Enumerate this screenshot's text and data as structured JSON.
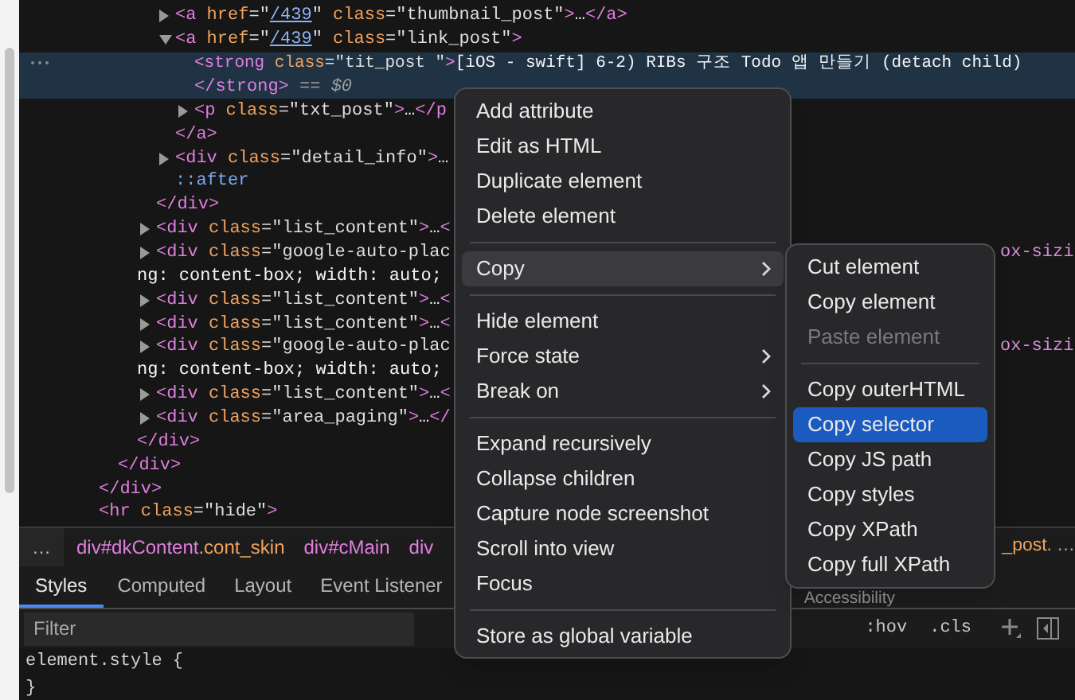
{
  "dom_tree": [
    {
      "children": [
        {
          "children": [
            {
              "children": [
                {
                  "children": [
                    {
                      "expanded": false,
                      "selected": false,
                      "segments": [
                        {
                          "kind": "tag",
                          "text": "<a"
                        },
                        {
                          "kind": "attr",
                          "text": " href"
                        },
                        {
                          "kind": "value",
                          "text": "=\""
                        },
                        {
                          "kind": "link",
                          "text": "/439"
                        },
                        {
                          "kind": "value",
                          "text": "\""
                        },
                        {
                          "kind": "attr",
                          "text": " class"
                        },
                        {
                          "kind": "value",
                          "text": "=\"thumbnail_post\""
                        },
                        {
                          "kind": "tag",
                          "text": ">"
                        },
                        {
                          "kind": "text",
                          "text": "…"
                        },
                        {
                          "kind": "tag",
                          "text": "</a>"
                        }
                      ]
                    },
                    {
                      "expanded": true,
                      "selected": false,
                      "segments": [
                        {
                          "kind": "tag",
                          "text": "<a"
                        },
                        {
                          "kind": "attr",
                          "text": " href"
                        },
                        {
                          "kind": "value",
                          "text": "=\""
                        },
                        {
                          "kind": "link",
                          "text": "/439"
                        },
                        {
                          "kind": "value",
                          "text": "\""
                        },
                        {
                          "kind": "attr",
                          "text": " class"
                        },
                        {
                          "kind": "value",
                          "text": "=\"link_post\""
                        },
                        {
                          "kind": "tag",
                          "text": ">"
                        }
                      ],
                      "children": [
                        {
                          "selected": true,
                          "segments": [
                            {
                              "kind": "tag",
                              "text": "<strong"
                            },
                            {
                              "kind": "attr",
                              "text": " class"
                            },
                            {
                              "kind": "value",
                              "text": "=\"tit_post \""
                            },
                            {
                              "kind": "tag",
                              "text": ">"
                            },
                            {
                              "kind": "text",
                              "text": "[iOS - swift] 6-2) RIBs 구조 Todo 앱 만들기 (detach child)"
                            }
                          ],
                          "continuation": {
                            "hanging": false,
                            "segments": [
                              {
                                "kind": "tag",
                                "text": "</strong>"
                              },
                              {
                                "kind": "muted",
                                "text": " == "
                              },
                              {
                                "kind": "var",
                                "text": "$0"
                              }
                            ]
                          }
                        },
                        {
                          "expanded": false,
                          "selected": false,
                          "segments": [
                            {
                              "kind": "tag",
                              "text": "<p"
                            },
                            {
                              "kind": "attr",
                              "text": " class"
                            },
                            {
                              "kind": "value",
                              "text": "=\"txt_post\""
                            },
                            {
                              "kind": "tag",
                              "text": ">"
                            },
                            {
                              "kind": "text",
                              "text": "…"
                            },
                            {
                              "kind": "tag",
                              "text": "</p"
                            }
                          ]
                        }
                      ]
                    },
                    {
                      "selected": false,
                      "segments": [
                        {
                          "kind": "tag",
                          "text": "</a>"
                        }
                      ]
                    },
                    {
                      "expanded": false,
                      "selected": false,
                      "segments": [
                        {
                          "kind": "tag",
                          "text": "<div"
                        },
                        {
                          "kind": "attr",
                          "text": " class"
                        },
                        {
                          "kind": "value",
                          "text": "=\"detail_info\""
                        },
                        {
                          "kind": "tag",
                          "text": ">"
                        },
                        {
                          "kind": "text",
                          "text": "…"
                        }
                      ]
                    },
                    {
                      "selected": false,
                      "segments": [
                        {
                          "kind": "pseudo",
                          "text": "::after"
                        }
                      ]
                    }
                  ]
                },
                {
                  "selected": false,
                  "segments": [
                    {
                      "kind": "tag",
                      "text": "</div>"
                    }
                  ]
                },
                {
                  "expanded": false,
                  "selected": false,
                  "segments": [
                    {
                      "kind": "tag",
                      "text": "<div"
                    },
                    {
                      "kind": "attr",
                      "text": " class"
                    },
                    {
                      "kind": "value",
                      "text": "=\"list_content\""
                    },
                    {
                      "kind": "tag",
                      "text": ">"
                    },
                    {
                      "kind": "text",
                      "text": "…"
                    },
                    {
                      "kind": "tag",
                      "text": "<"
                    }
                  ]
                },
                {
                  "expanded": false,
                  "selected": false,
                  "segments": [
                    {
                      "kind": "tag",
                      "text": "<div"
                    },
                    {
                      "kind": "attr",
                      "text": " class"
                    },
                    {
                      "kind": "value",
                      "text": "=\"google-auto-plac"
                    }
                  ],
                  "right_fragment": "ox-sizi",
                  "continuation": {
                    "hanging": true,
                    "segments": [
                      {
                        "kind": "text",
                        "text": "ng: content-box; width: auto;"
                      }
                    ]
                  }
                },
                {
                  "expanded": false,
                  "selected": false,
                  "segments": [
                    {
                      "kind": "tag",
                      "text": "<div"
                    },
                    {
                      "kind": "attr",
                      "text": " class"
                    },
                    {
                      "kind": "value",
                      "text": "=\"list_content\""
                    },
                    {
                      "kind": "tag",
                      "text": ">"
                    },
                    {
                      "kind": "text",
                      "text": "…"
                    },
                    {
                      "kind": "tag",
                      "text": "<"
                    }
                  ]
                },
                {
                  "expanded": false,
                  "selected": false,
                  "segments": [
                    {
                      "kind": "tag",
                      "text": "<div"
                    },
                    {
                      "kind": "attr",
                      "text": " class"
                    },
                    {
                      "kind": "value",
                      "text": "=\"list_content\""
                    },
                    {
                      "kind": "tag",
                      "text": ">"
                    },
                    {
                      "kind": "text",
                      "text": "…"
                    },
                    {
                      "kind": "tag",
                      "text": "<"
                    }
                  ]
                },
                {
                  "expanded": false,
                  "selected": false,
                  "segments": [
                    {
                      "kind": "tag",
                      "text": "<div"
                    },
                    {
                      "kind": "attr",
                      "text": " class"
                    },
                    {
                      "kind": "value",
                      "text": "=\"google-auto-plac"
                    }
                  ],
                  "right_fragment": "ox-sizi",
                  "continuation": {
                    "hanging": true,
                    "segments": [
                      {
                        "kind": "text",
                        "text": "ng: content-box; width: auto;"
                      }
                    ]
                  }
                },
                {
                  "expanded": false,
                  "selected": false,
                  "segments": [
                    {
                      "kind": "tag",
                      "text": "<div"
                    },
                    {
                      "kind": "attr",
                      "text": " class"
                    },
                    {
                      "kind": "value",
                      "text": "=\"list_content\""
                    },
                    {
                      "kind": "tag",
                      "text": ">"
                    },
                    {
                      "kind": "text",
                      "text": "…"
                    },
                    {
                      "kind": "tag",
                      "text": "<"
                    }
                  ]
                },
                {
                  "expanded": false,
                  "selected": false,
                  "segments": [
                    {
                      "kind": "tag",
                      "text": "<div"
                    },
                    {
                      "kind": "attr",
                      "text": " class"
                    },
                    {
                      "kind": "value",
                      "text": "=\"area_paging\""
                    },
                    {
                      "kind": "tag",
                      "text": ">"
                    },
                    {
                      "kind": "text",
                      "text": "…"
                    },
                    {
                      "kind": "tag",
                      "text": "</"
                    }
                  ]
                }
              ]
            },
            {
              "selected": false,
              "segments": [
                {
                  "kind": "tag",
                  "text": "</div>"
                }
              ]
            }
          ]
        },
        {
          "selected": false,
          "segments": [
            {
              "kind": "tag",
              "text": "</div>"
            }
          ]
        }
      ]
    },
    {
      "selected": false,
      "segments": [
        {
          "kind": "tag",
          "text": "</div>"
        }
      ]
    },
    {
      "selected": false,
      "segments": [
        {
          "kind": "tag",
          "text": "<hr"
        },
        {
          "kind": "attr",
          "text": " class"
        },
        {
          "kind": "value",
          "text": "=\"hide\""
        },
        {
          "kind": "tag",
          "text": ">"
        }
      ]
    }
  ],
  "breadcrumbs": {
    "more": "…",
    "items": [
      {
        "segments": [
          {
            "kind": "tag",
            "text": "div#dkContent"
          },
          {
            "kind": "class",
            "text": ".cont_skin"
          }
        ]
      },
      {
        "segments": [
          {
            "kind": "tag",
            "text": "div#cMain"
          }
        ]
      },
      {
        "segments": [
          {
            "kind": "tag",
            "text": "div"
          }
        ]
      }
    ],
    "right_items": [
      {
        "segments": [
          {
            "kind": "class",
            "text": "_post."
          }
        ]
      }
    ],
    "overflow": "…"
  },
  "tabs": [
    {
      "label": "Styles",
      "selected": true
    },
    {
      "label": "Computed",
      "selected": false
    },
    {
      "label": "Layout",
      "selected": false
    },
    {
      "label": "Event Listener",
      "selected": false
    }
  ],
  "right_tab": "Accessibility",
  "filter": {
    "placeholder": "Filter",
    "hov": ":hov",
    "cls": ".cls"
  },
  "styles": [
    "element.style {",
    "}"
  ],
  "context_menu": {
    "focused": false,
    "items": [
      {
        "kind": "item",
        "label": "Add attribute",
        "submenu": false,
        "selected": false
      },
      {
        "kind": "item",
        "label": "Edit as HTML",
        "submenu": false,
        "selected": false
      },
      {
        "kind": "item",
        "label": "Duplicate element",
        "submenu": false,
        "selected": false
      },
      {
        "kind": "item",
        "label": "Delete element",
        "submenu": false,
        "selected": false
      },
      {
        "kind": "separator"
      },
      {
        "kind": "item",
        "label": "Copy",
        "submenu": true,
        "selected": true
      },
      {
        "kind": "separator"
      },
      {
        "kind": "item",
        "label": "Hide element",
        "submenu": false,
        "selected": false
      },
      {
        "kind": "item",
        "label": "Force state",
        "submenu": true,
        "selected": false
      },
      {
        "kind": "item",
        "label": "Break on",
        "submenu": true,
        "selected": false
      },
      {
        "kind": "separator"
      },
      {
        "kind": "item",
        "label": "Expand recursively",
        "submenu": false,
        "selected": false
      },
      {
        "kind": "item",
        "label": "Collapse children",
        "submenu": false,
        "selected": false
      },
      {
        "kind": "item",
        "label": "Capture node screenshot",
        "submenu": false,
        "selected": false
      },
      {
        "kind": "item",
        "label": "Scroll into view",
        "submenu": false,
        "selected": false
      },
      {
        "kind": "item",
        "label": "Focus",
        "submenu": false,
        "selected": false
      },
      {
        "kind": "separator"
      },
      {
        "kind": "item",
        "label": "Store as global variable",
        "submenu": false,
        "selected": false
      }
    ]
  },
  "submenu": {
    "focused": true,
    "items": [
      {
        "kind": "item",
        "label": "Cut element",
        "disabled": false,
        "selected": false
      },
      {
        "kind": "item",
        "label": "Copy element",
        "disabled": false,
        "selected": false
      },
      {
        "kind": "item",
        "label": "Paste element",
        "disabled": true,
        "selected": false
      },
      {
        "kind": "separator"
      },
      {
        "kind": "item",
        "label": "Copy outerHTML",
        "disabled": false,
        "selected": false
      },
      {
        "kind": "item",
        "label": "Copy selector",
        "disabled": false,
        "selected": true
      },
      {
        "kind": "item",
        "label": "Copy JS path",
        "disabled": false,
        "selected": false
      },
      {
        "kind": "item",
        "label": "Copy styles",
        "disabled": false,
        "selected": false
      },
      {
        "kind": "item",
        "label": "Copy XPath",
        "disabled": false,
        "selected": false
      },
      {
        "kind": "item",
        "label": "Copy full XPath",
        "disabled": false,
        "selected": false
      }
    ]
  }
}
